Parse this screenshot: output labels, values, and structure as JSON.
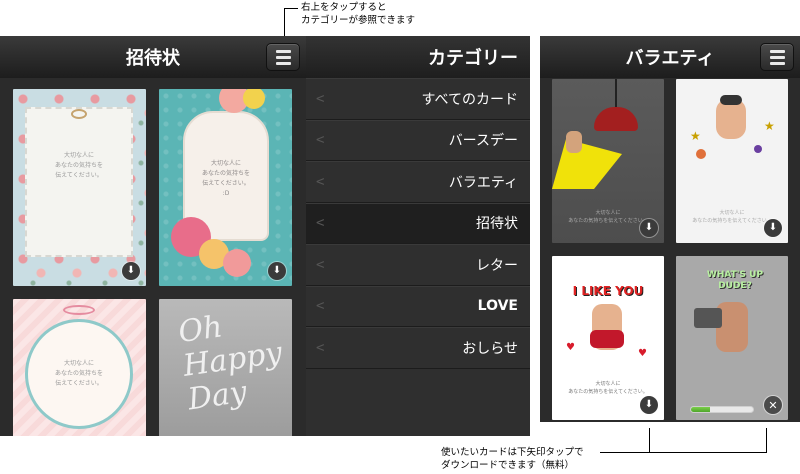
{
  "annotations": {
    "top_note": "右上をタップすると\nカテゴリーが参照できます",
    "bottom_note": "使いたいカードは下矢印タップで\nダウンロードできます（無料）"
  },
  "panel1": {
    "title": "招待状",
    "cards": [
      {
        "message": "大切な人に\nあなたの気持ちを\n伝えてください。",
        "download_icon": "download-icon"
      },
      {
        "message": "大切な人に\nあなたの気持ちを\n伝えてください。\n:D",
        "download_icon": "download-icon"
      },
      {
        "message": "大切な人に\nあなたの気持ちを\n伝えてください。"
      },
      {
        "script_text": "Oh\nHappy\nDay"
      }
    ]
  },
  "panel2": {
    "title": "カテゴリー",
    "items": [
      {
        "label": "すべてのカード"
      },
      {
        "label": "バースデー"
      },
      {
        "label": "バラエティ"
      },
      {
        "label": "招待状",
        "active": true
      },
      {
        "label": "レター"
      },
      {
        "label": "LOVE"
      },
      {
        "label": "おしらせ"
      }
    ]
  },
  "panel3": {
    "title": "バラエティ",
    "cards": [
      {
        "message": "大切な人に\nあなたの気持ちを伝えてください。"
      },
      {
        "message": "大切な人に\nあなたの気持ちを伝えてください。"
      },
      {
        "headline": "I LIKE YOU",
        "message": "大切な人に\nあなたの気持ちを伝えてください。"
      },
      {
        "headline": "WHAT'S UP DUDE?",
        "download_progress": 0.3
      }
    ]
  },
  "colors": {
    "header_bg": "#2a2a2a",
    "panel_bg": "#2b2b2b",
    "progress_green": "#5bb52f"
  }
}
